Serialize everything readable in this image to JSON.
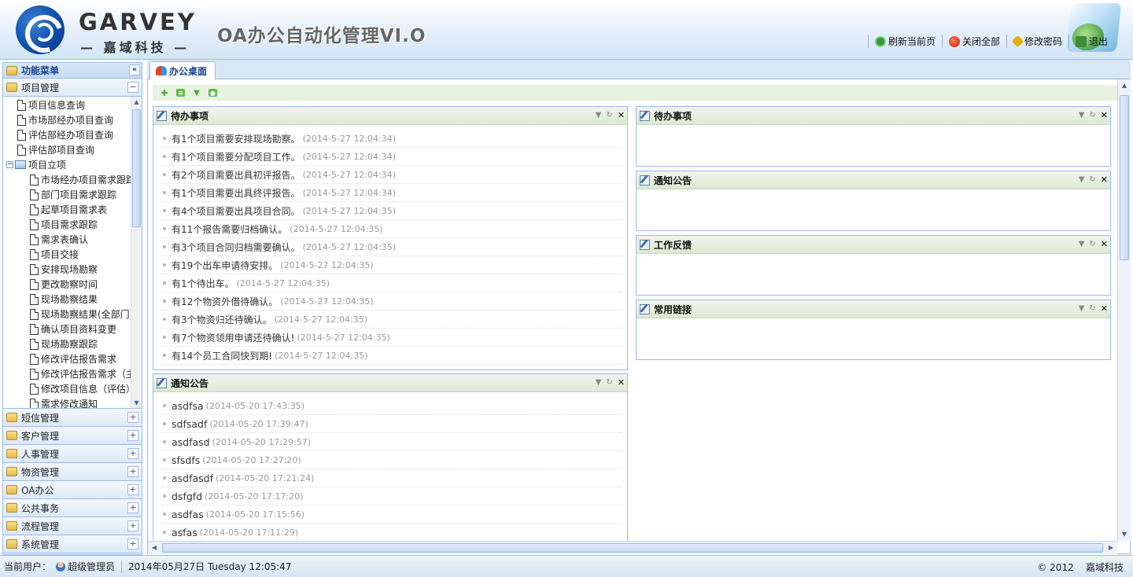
{
  "header": {
    "brand_en": "GARVEY",
    "brand_cn": "— 嘉域科技 —",
    "system_title": "OA办公自动化管理VI.O",
    "links": [
      {
        "label": "刷新当前页",
        "icon": "refresh-icon"
      },
      {
        "label": "关闭全部",
        "icon": "close-all-icon"
      },
      {
        "label": "修改密码",
        "icon": "key-icon"
      },
      {
        "label": "退出",
        "icon": "exit-icon"
      }
    ]
  },
  "sidebar": {
    "title": "功能菜单",
    "collapse_glyph": "«",
    "expanded_section": {
      "label": "项目管理",
      "toggle": "−"
    },
    "tree": [
      {
        "label": "项目信息查询",
        "level": 1
      },
      {
        "label": "市场部经办项目查询",
        "level": 1
      },
      {
        "label": "评估部经办项目查询",
        "level": 1
      },
      {
        "label": "评估部项目查询",
        "level": 1
      },
      {
        "label": "项目立项",
        "level": 0,
        "folder": true
      },
      {
        "label": "市场经办项目需求跟踪",
        "level": 2
      },
      {
        "label": "部门项目需求跟踪",
        "level": 2
      },
      {
        "label": "起草项目需求表",
        "level": 2
      },
      {
        "label": "项目需求跟踪",
        "level": 2
      },
      {
        "label": "需求表确认",
        "level": 2
      },
      {
        "label": "项目交接",
        "level": 2
      },
      {
        "label": "安排现场勘察",
        "level": 2
      },
      {
        "label": "更改勘察时间",
        "level": 2
      },
      {
        "label": "现场勘察结果",
        "level": 2
      },
      {
        "label": "现场勘察结果(全部门)",
        "level": 2
      },
      {
        "label": "确认项目资料变更",
        "level": 2
      },
      {
        "label": "现场勘察跟踪",
        "level": 2
      },
      {
        "label": "修改评估报告需求",
        "level": 2
      },
      {
        "label": "修改评估报告需求（主）",
        "level": 2
      },
      {
        "label": "修改项目信息（评估）",
        "level": 2
      },
      {
        "label": "需求修改通知",
        "level": 2
      }
    ],
    "sections": [
      {
        "label": "短信管理",
        "toggle": "+"
      },
      {
        "label": "客户管理",
        "toggle": "+"
      },
      {
        "label": "人事管理",
        "toggle": "+"
      },
      {
        "label": "物资管理",
        "toggle": "+"
      },
      {
        "label": "OA办公",
        "toggle": "+"
      },
      {
        "label": "公共事务",
        "toggle": "+"
      },
      {
        "label": "流程管理",
        "toggle": "+"
      },
      {
        "label": "系统管理",
        "toggle": "+"
      }
    ]
  },
  "tabs": [
    {
      "label": "办公桌面",
      "active": true
    }
  ],
  "toolbar": {
    "buttons": [
      "add-icon",
      "edit-icon",
      "dropdown-icon",
      "settings-icon"
    ]
  },
  "portlets": {
    "todo_left": {
      "title": "待办事项",
      "items": [
        {
          "text": "有1个项目需要安排现场勘察。",
          "time": "(2014-5-27 12:04:34)"
        },
        {
          "text": "有1个项目需要分配项目工作。",
          "time": "(2014-5-27 12:04:34)"
        },
        {
          "text": "有2个项目需要出具初评报告。",
          "time": "(2014-5-27 12:04:34)"
        },
        {
          "text": "有1个项目需要出具终评报告。",
          "time": "(2014-5-27 12:04:34)"
        },
        {
          "text": "有4个项目需要出具项目合同。",
          "time": "(2014-5-27 12:04:35)"
        },
        {
          "text": "有11个报告需要归档确认。",
          "time": "(2014-5-27 12:04:35)"
        },
        {
          "text": "有3个项目合同归档需要确认。",
          "time": "(2014-5-27 12:04:35)"
        },
        {
          "text": "有19个出车申请待安排。",
          "time": "(2014-5-27 12:04:35)"
        },
        {
          "text": "有1个待出车。",
          "time": "(2014-5-27 12:04:35)"
        },
        {
          "text": "有12个物资外借待确认。",
          "time": "(2014-5-27 12:04:35)"
        },
        {
          "text": "有3个物资归还待确认。",
          "time": "(2014-5-27 12:04:35)"
        },
        {
          "text": "有7个物资领用申请还待确认!",
          "time": "(2014-5-27 12:04:35)"
        },
        {
          "text": "有14个员工合同快到期!",
          "time": "(2014-5-27 12:04:35)"
        }
      ]
    },
    "notice_left": {
      "title": "通知公告",
      "items": [
        {
          "text": "asdfsa",
          "time": "(2014-05-20 17:43:35)"
        },
        {
          "text": "sdfsadf",
          "time": "(2014-05-20 17:39:47)"
        },
        {
          "text": "asdfasd",
          "time": "(2014-05-20 17:29:57)"
        },
        {
          "text": "sfsdfs",
          "time": "(2014-05-20 17:27:20)"
        },
        {
          "text": "asdfasdf",
          "time": "(2014-05-20 17:21:24)"
        },
        {
          "text": "dsfgfd",
          "time": "(2014-05-20 17:17:20)"
        },
        {
          "text": "asdfas",
          "time": "(2014-05-20 17:15:56)"
        },
        {
          "text": "asfas",
          "time": "(2014-05-20 17:11:29)"
        }
      ]
    },
    "right": [
      {
        "title": "待办事项"
      },
      {
        "title": "通知公告"
      },
      {
        "title": "工作反馈"
      },
      {
        "title": "常用链接"
      }
    ]
  },
  "footer": {
    "user_label": "当前用户：",
    "user_name": "超级管理员",
    "datetime": "2014年05月27日  Tuesday 12:05:47",
    "copyright": "© 2012",
    "company": "嘉域科技"
  }
}
